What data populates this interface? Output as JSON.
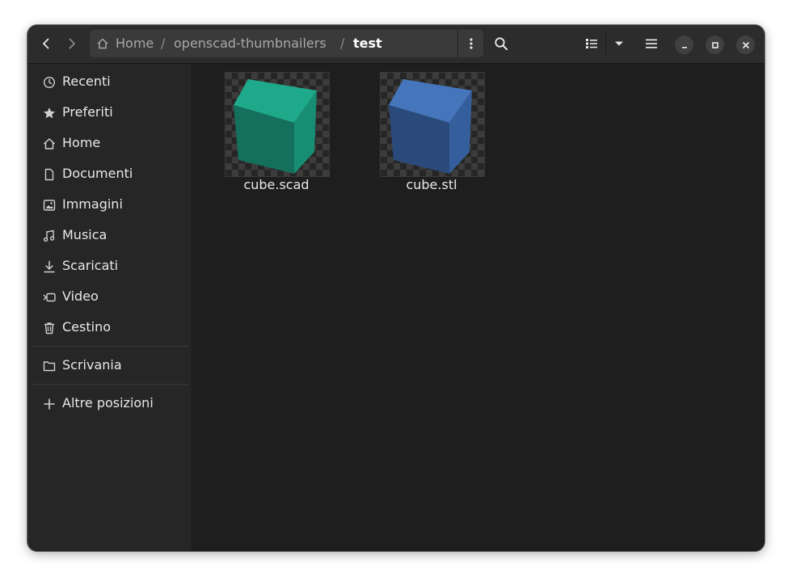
{
  "headerbar": {
    "back_icon": "go-back-icon",
    "forward_icon": "go-forward-icon",
    "breadcrumbs": [
      {
        "label": "Home",
        "icon": "home-icon"
      },
      {
        "label": "openscad-thumbnailers"
      },
      {
        "label": "test"
      }
    ],
    "separator": "/",
    "path_menu_icon": "kebab-menu-icon",
    "search_icon": "search-icon",
    "view_icon": "list-view-icon",
    "view_dropdown_icon": "chevron-down-icon",
    "menu_icon": "hamburger-menu-icon",
    "window_controls": [
      "minimize-icon",
      "maximize-icon",
      "close-icon"
    ]
  },
  "sidebar": {
    "items": [
      {
        "label": "Recenti",
        "icon": "clock-icon"
      },
      {
        "label": "Preferiti",
        "icon": "star-icon"
      },
      {
        "label": "Home",
        "icon": "home-icon"
      },
      {
        "label": "Documenti",
        "icon": "document-icon"
      },
      {
        "label": "Immagini",
        "icon": "image-icon"
      },
      {
        "label": "Musica",
        "icon": "music-icon"
      },
      {
        "label": "Scaricati",
        "icon": "download-icon"
      },
      {
        "label": "Video",
        "icon": "video-icon"
      },
      {
        "label": "Cestino",
        "icon": "trash-icon"
      }
    ],
    "bookmarks": [
      {
        "label": "Scrivania",
        "icon": "folder-icon"
      }
    ],
    "other": {
      "label": "Altre posizioni",
      "icon": "plus-icon"
    }
  },
  "files": [
    {
      "name": "cube.scad",
      "cube_colors": {
        "top": "#1fa98b",
        "left": "#14705c",
        "right": "#178d74"
      }
    },
    {
      "name": "cube.stl",
      "cube_colors": {
        "top": "#4575bb",
        "left": "#2b4a7c",
        "right": "#355f9c"
      }
    }
  ]
}
